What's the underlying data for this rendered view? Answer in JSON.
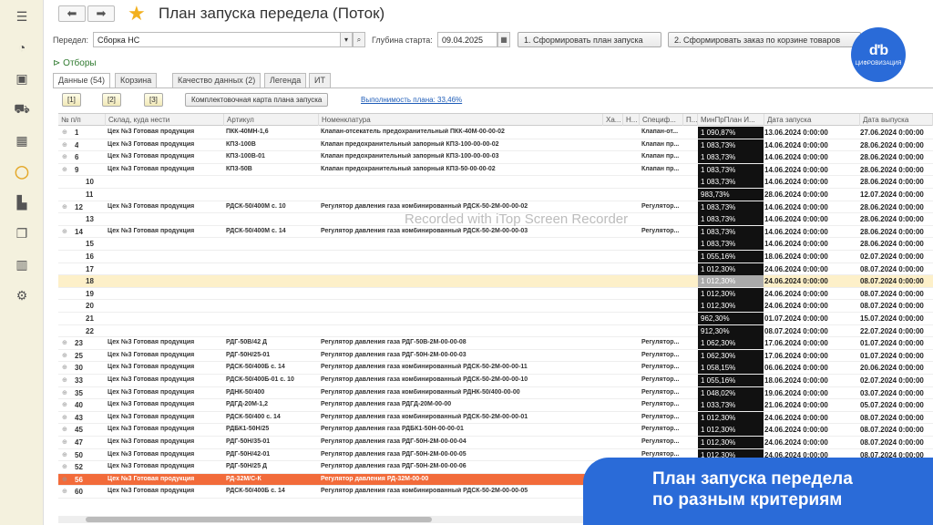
{
  "sidebar": {
    "icons": [
      "menu-icon",
      "pie-chart-icon",
      "bag-icon",
      "cart-icon",
      "table-icon",
      "ring-chart-icon",
      "factory-icon",
      "documents-icon",
      "bar-chart-icon",
      "gear-icon"
    ]
  },
  "header": {
    "back": "⬅",
    "forward": "➡",
    "title": "План запуска передела (Поток)"
  },
  "form": {
    "peredel_label": "Передел:",
    "peredel_value": "Сборка НС",
    "depth_label": "Глубина старта:",
    "depth_value": "09.04.2025",
    "btn_plan": "1. Сформировать план запуска",
    "btn_order": "2. Сформировать заказ по корзине товаров"
  },
  "logo": {
    "text": "ЦИФРОВИЗАЦИЯ"
  },
  "filters": {
    "label": "Отборы"
  },
  "tabs": [
    "Данные (54)",
    "Корзина",
    "Качество данных (2)",
    "Легенда",
    "ИТ"
  ],
  "toolbar": {
    "b1": "[1]",
    "b2": "[2]",
    "b3": "[3]",
    "kart": "Комплектовочная карта плана запуска",
    "vypoln": "Выполнимость плана: 33,46%"
  },
  "columns": [
    "№ п/п",
    "Склад, куда нести",
    "Артикул",
    "Номенклатура",
    "Ха...",
    "Н...",
    "Специф...",
    "П...",
    "МинПрПлан И...",
    "Дата запуска",
    "Дата выпуска"
  ],
  "rows": [
    {
      "n": "1",
      "s": "Цех №3 Готовая продукция",
      "a": "ПКК-40МН-1,6",
      "nom": "Клапан-отсекатель предохранительный ПКК-40М-00-00-02",
      "sp": "Клапан-от...",
      "min": "1 090,87%",
      "ds": "13.06.2024 0:00:00",
      "dv": "27.06.2024 0:00:00"
    },
    {
      "n": "4",
      "s": "Цех №3 Готовая продукция",
      "a": "КПЗ-100В",
      "nom": "Клапан предохранительный запорный КПЗ-100-00-00-02",
      "sp": "Клапан пр...",
      "min": "1 083,73%",
      "ds": "14.06.2024 0:00:00",
      "dv": "28.06.2024 0:00:00"
    },
    {
      "n": "6",
      "s": "Цех №3 Готовая продукция",
      "a": "КПЗ-100В-01",
      "nom": "Клапан предохранительный запорный КПЗ-100-00-00-03",
      "sp": "Клапан пр...",
      "min": "1 083,73%",
      "ds": "14.06.2024 0:00:00",
      "dv": "28.06.2024 0:00:00"
    },
    {
      "n": "9",
      "s": "Цех №3 Готовая продукция",
      "a": "КПЗ-50В",
      "nom": "Клапан предохранительный запорный КПЗ-50-00-00-02",
      "sp": "Клапан пр...",
      "min": "1 083,73%",
      "ds": "14.06.2024 0:00:00",
      "dv": "28.06.2024 0:00:00"
    },
    {
      "n": "10",
      "s": "",
      "a": "",
      "nom": "",
      "sp": "",
      "min": "1 083,73%",
      "ds": "14.06.2024 0:00:00",
      "dv": "28.06.2024 0:00:00"
    },
    {
      "n": "11",
      "s": "",
      "a": "",
      "nom": "",
      "sp": "",
      "min": "983,73%",
      "ds": "28.06.2024 0:00:00",
      "dv": "12.07.2024 0:00:00"
    },
    {
      "n": "12",
      "s": "Цех №3 Готовая продукция",
      "a": "РДСК-50/400М с. 10",
      "nom": "Регулятор давления газа комбинированный РДСК-50-2М-00-00-02",
      "sp": "Регулятор...",
      "min": "1 083,73%",
      "ds": "14.06.2024 0:00:00",
      "dv": "28.06.2024 0:00:00"
    },
    {
      "n": "13",
      "s": "",
      "a": "",
      "nom": "",
      "sp": "",
      "min": "1 083,73%",
      "ds": "14.06.2024 0:00:00",
      "dv": "28.06.2024 0:00:00"
    },
    {
      "n": "14",
      "s": "Цех №3 Готовая продукция",
      "a": "РДСК-50/400М с. 14",
      "nom": "Регулятор давления газа комбинированный РДСК-50-2М-00-00-03",
      "sp": "Регулятор...",
      "min": "1 083,73%",
      "ds": "14.06.2024 0:00:00",
      "dv": "28.06.2024 0:00:00"
    },
    {
      "n": "15",
      "s": "",
      "a": "",
      "nom": "",
      "sp": "",
      "min": "1 083,73%",
      "ds": "14.06.2024 0:00:00",
      "dv": "28.06.2024 0:00:00"
    },
    {
      "n": "16",
      "s": "",
      "a": "",
      "nom": "",
      "sp": "",
      "min": "1 055,16%",
      "ds": "18.06.2024 0:00:00",
      "dv": "02.07.2024 0:00:00"
    },
    {
      "n": "17",
      "s": "",
      "a": "",
      "nom": "",
      "sp": "",
      "min": "1 012,30%",
      "ds": "24.06.2024 0:00:00",
      "dv": "08.07.2024 0:00:00"
    },
    {
      "n": "18",
      "s": "",
      "a": "",
      "nom": "",
      "sp": "",
      "min": "1 012,30%",
      "ds": "24.06.2024 0:00:00",
      "dv": "08.07.2024 0:00:00"
    },
    {
      "n": "19",
      "s": "",
      "a": "",
      "nom": "",
      "sp": "",
      "min": "1 012,30%",
      "ds": "24.06.2024 0:00:00",
      "dv": "08.07.2024 0:00:00"
    },
    {
      "n": "20",
      "s": "",
      "a": "",
      "nom": "",
      "sp": "",
      "min": "1 012,30%",
      "ds": "24.06.2024 0:00:00",
      "dv": "08.07.2024 0:00:00"
    },
    {
      "n": "21",
      "s": "",
      "a": "",
      "nom": "",
      "sp": "",
      "min": "962,30%",
      "ds": "01.07.2024 0:00:00",
      "dv": "15.07.2024 0:00:00"
    },
    {
      "n": "22",
      "s": "",
      "a": "",
      "nom": "",
      "sp": "",
      "min": "912,30%",
      "ds": "08.07.2024 0:00:00",
      "dv": "22.07.2024 0:00:00"
    },
    {
      "n": "23",
      "s": "Цех №3 Готовая продукция",
      "a": "РДГ-50В/42 Д",
      "nom": "Регулятор давления газа РДГ-50В-2М-00-00-08",
      "sp": "Регулятор...",
      "min": "1 062,30%",
      "ds": "17.06.2024 0:00:00",
      "dv": "01.07.2024 0:00:00"
    },
    {
      "n": "25",
      "s": "Цех №3 Готовая продукция",
      "a": "РДГ-50Н/25-01",
      "nom": "Регулятор давления газа РДГ-50Н-2М-00-00-03",
      "sp": "Регулятор...",
      "min": "1 062,30%",
      "ds": "17.06.2024 0:00:00",
      "dv": "01.07.2024 0:00:00"
    },
    {
      "n": "30",
      "s": "Цех №3 Готовая продукция",
      "a": "РДСК-50/400Б с. 14",
      "nom": "Регулятор давления газа комбинированный РДСК-50-2М-00-00-11",
      "sp": "Регулятор...",
      "min": "1 058,15%",
      "ds": "06.06.2024 0:00:00",
      "dv": "20.06.2024 0:00:00"
    },
    {
      "n": "33",
      "s": "Цех №3 Готовая продукция",
      "a": "РДСК-50/400Б-01 с. 10",
      "nom": "Регулятор давления газа комбинированный РДСК-50-2М-00-00-10",
      "sp": "Регулятор...",
      "min": "1 055,16%",
      "ds": "18.06.2024 0:00:00",
      "dv": "02.07.2024 0:00:00"
    },
    {
      "n": "35",
      "s": "Цех №3 Готовая продукция",
      "a": "РДНК-50/400",
      "nom": "Регулятор давления газа комбинированный РДНК-50/400-00-00",
      "sp": "Регулятор...",
      "min": "1 048,02%",
      "ds": "19.06.2024 0:00:00",
      "dv": "03.07.2024 0:00:00"
    },
    {
      "n": "40",
      "s": "Цех №3 Готовая продукция",
      "a": "РДГД-20М-1,2",
      "nom": "Регулятор давления газа РДГД-20М-00-00",
      "sp": "Регулятор...",
      "min": "1 033,73%",
      "ds": "21.06.2024 0:00:00",
      "dv": "05.07.2024 0:00:00"
    },
    {
      "n": "43",
      "s": "Цех №3 Готовая продукция",
      "a": "РДСК-50/400 с. 14",
      "nom": "Регулятор давления газа комбинированный РДСК-50-2М-00-00-01",
      "sp": "Регулятор...",
      "min": "1 012,30%",
      "ds": "24.06.2024 0:00:00",
      "dv": "08.07.2024 0:00:00"
    },
    {
      "n": "45",
      "s": "Цех №3 Готовая продукция",
      "a": "РДБК1-50Н/25",
      "nom": "Регулятор давления газа РДБК1-50Н-00-00-01",
      "sp": "Регулятор...",
      "min": "1 012,30%",
      "ds": "24.06.2024 0:00:00",
      "dv": "08.07.2024 0:00:00"
    },
    {
      "n": "47",
      "s": "Цех №3 Готовая продукция",
      "a": "РДГ-50Н/35-01",
      "nom": "Регулятор давления газа РДГ-50Н-2М-00-00-04",
      "sp": "Регулятор...",
      "min": "1 012,30%",
      "ds": "24.06.2024 0:00:00",
      "dv": "08.07.2024 0:00:00"
    },
    {
      "n": "50",
      "s": "Цех №3 Готовая продукция",
      "a": "РДГ-50Н/42-01",
      "nom": "Регулятор давления газа РДГ-50Н-2М-00-00-05",
      "sp": "Регулятор...",
      "min": "1 012,30%",
      "ds": "24.06.2024 0:00:00",
      "dv": "08.07.2024 0:00:00"
    },
    {
      "n": "52",
      "s": "Цех №3 Готовая продукция",
      "a": "РДГ-50Н/25 Д",
      "nom": "Регулятор давления газа РДГ-50Н-2М-00-00-06",
      "sp": "Регулятор...",
      "min": "1 012,30%",
      "ds": "24.06.2024 0:00:00",
      "dv": "08.07.2024 0:00:00"
    },
    {
      "n": "56",
      "s": "Цех №3 Готовая продукция",
      "a": "РД-32М/С-К",
      "nom": "Регулятор давления РД-32М-00-00",
      "sp": "",
      "min": "",
      "ds": "",
      "dv": ""
    },
    {
      "n": "60",
      "s": "Цех №3 Готовая продукция",
      "a": "РДСК-50/400Б с. 14",
      "nom": "Регулятор давления газа комбинированный РДСК-50-2М-00-00-05",
      "sp": "",
      "min": "",
      "ds": "",
      "dv": ""
    }
  ],
  "watermark": "Recorded with iTop Screen Recorder",
  "caption": {
    "line1": "План запуска передела",
    "line2": "по разным критериям"
  }
}
